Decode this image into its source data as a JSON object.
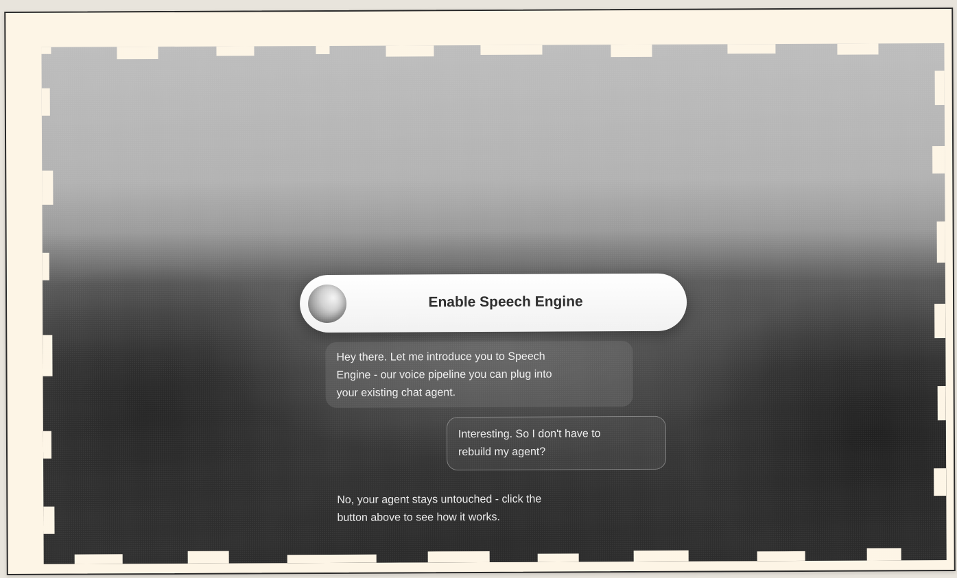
{
  "app": {
    "enable_button": {
      "label": "Enable Speech Engine",
      "icon": "orb-icon"
    }
  },
  "conversation": {
    "messages": [
      {
        "role": "agent",
        "text": "Hey there. Let me introduce you to Speech\nEngine - our voice pipeline you can plug into\nyour existing chat agent."
      },
      {
        "role": "user",
        "text": "Interesting. So I don't have to\nrebuild my agent?"
      },
      {
        "role": "agent",
        "text": "No, your agent stays untouched - click the\nbutton above to see how it works."
      }
    ]
  },
  "colors": {
    "paper": "#fdf5e6",
    "pill_bg": "#ffffff",
    "pill_text": "#2a2a2a",
    "bubble_text": "#ffffff"
  }
}
